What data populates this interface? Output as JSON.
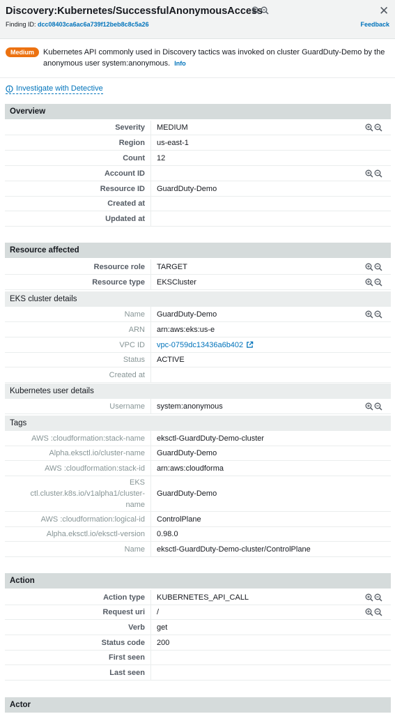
{
  "header": {
    "title": "Discovery:Kubernetes/SuccessfulAnonymousAccess",
    "finding_label": "Finding ID:",
    "finding_id": "dcc08403ca6ac6a739f12beb8c8c5a26",
    "feedback": "Feedback"
  },
  "alert": {
    "severity_badge": "Medium",
    "message": "Kubernetes API commonly used in Discovery tactics was invoked on cluster GuardDuty-Demo by the anonymous user system:anonymous.",
    "info": "Info"
  },
  "investigate": "Investigate with Detective",
  "overview": {
    "title": "Overview",
    "rows": [
      {
        "key": "Severity",
        "value": "MEDIUM"
      },
      {
        "key": "Region",
        "value": "us-east-1"
      },
      {
        "key": "Count",
        "value": "12"
      },
      {
        "key": "Account ID",
        "value": ""
      },
      {
        "key": "Resource ID",
        "value": "GuardDuty-Demo"
      },
      {
        "key": "Created at",
        "value": ""
      },
      {
        "key": "Updated at",
        "value": ""
      }
    ]
  },
  "resource": {
    "title": "Resource affected",
    "rows": [
      {
        "key": "Resource role",
        "value": "TARGET"
      },
      {
        "key": "Resource type",
        "value": "EKSCluster"
      }
    ],
    "eks": {
      "title": "EKS cluster details",
      "rows": [
        {
          "key": "Name",
          "value": "GuardDuty-Demo"
        },
        {
          "key": "ARN",
          "value": "arn:aws:eks:us-e"
        },
        {
          "key": "VPC ID",
          "value": "vpc-0759dc13436a6b402"
        },
        {
          "key": "Status",
          "value": "ACTIVE"
        },
        {
          "key": "Created at",
          "value": ""
        }
      ]
    },
    "k8s": {
      "title": "Kubernetes user details",
      "rows": [
        {
          "key": "Username",
          "value": "system:anonymous"
        }
      ]
    },
    "tags": {
      "title": "Tags",
      "rows": [
        {
          "key": "AWS :cloudformation:stack-name",
          "value": "eksctl-GuardDuty-Demo-cluster"
        },
        {
          "key": "Alpha.eksctl.io/cluster-name",
          "value": "GuardDuty-Demo"
        },
        {
          "key": "AWS :cloudformation:stack-id",
          "value": "arn:aws:cloudforma"
        },
        {
          "key_lines": [
            "EKS",
            "ctl.cluster.k8s.io/v1alpha1/cluster-",
            "name"
          ],
          "value": "GuardDuty-Demo"
        },
        {
          "key": "AWS :cloudformation:logical-id",
          "value": "ControlPlane"
        },
        {
          "key": "Alpha.eksctl.io/eksctl-version",
          "value": "0.98.0"
        },
        {
          "key": "Name",
          "value": "eksctl-GuardDuty-Demo-cluster/ControlPlane"
        }
      ]
    }
  },
  "action": {
    "title": "Action",
    "rows": [
      {
        "key": "Action type",
        "value": "KUBERNETES_API_CALL"
      },
      {
        "key": "Request uri",
        "value": "/"
      },
      {
        "key": "Verb",
        "value": "get"
      },
      {
        "key": "Status code",
        "value": "200"
      },
      {
        "key": "First seen",
        "value": ""
      },
      {
        "key": "Last seen",
        "value": ""
      }
    ]
  },
  "actor": {
    "title": "Actor"
  },
  "colors": {
    "accent": "#0073bb",
    "badge": "#ec7211",
    "section_head": "#d5dbdb",
    "sub_head": "#eaeded"
  }
}
